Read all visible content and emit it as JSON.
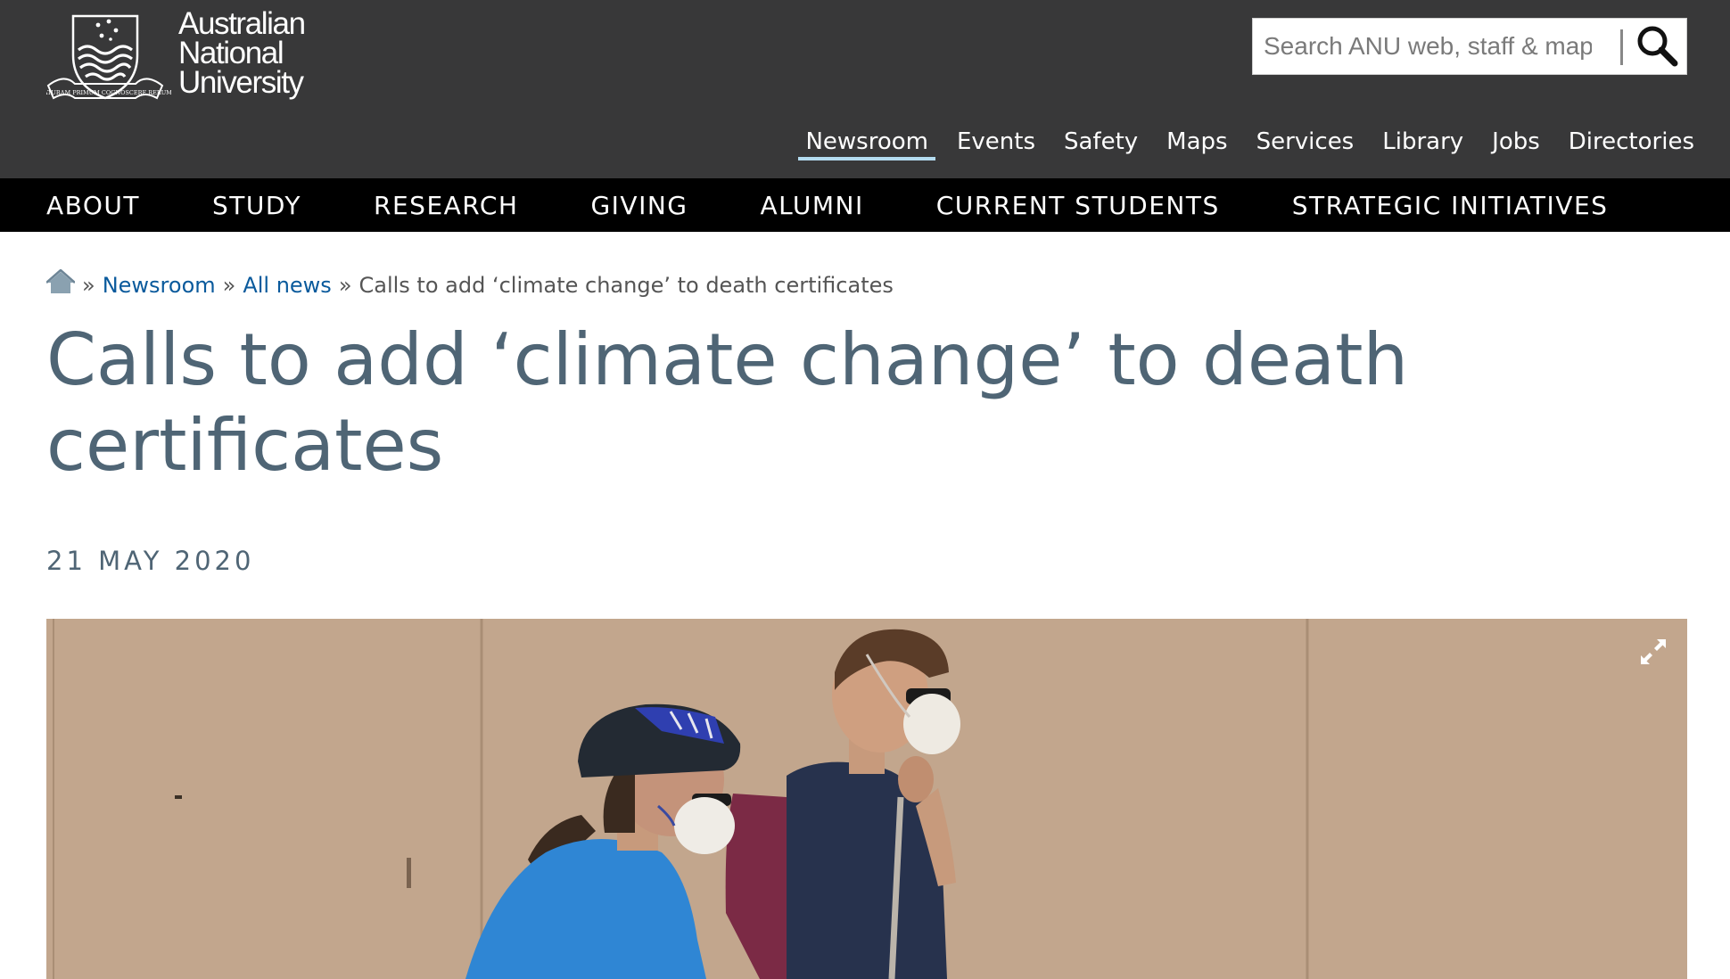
{
  "header": {
    "logo": {
      "line1": "Australian",
      "line2": "National",
      "line3": "University",
      "motto": "NATURAM PRIMUM COGNOSCERE RERUM"
    },
    "search": {
      "placeholder": "Search ANU web, staff & maps"
    },
    "utility_nav": [
      {
        "label": "Newsroom",
        "active": true
      },
      {
        "label": "Events"
      },
      {
        "label": "Safety"
      },
      {
        "label": "Maps"
      },
      {
        "label": "Services"
      },
      {
        "label": "Library"
      },
      {
        "label": "Jobs"
      },
      {
        "label": "Directories"
      }
    ]
  },
  "main_nav": [
    {
      "label": "ABOUT"
    },
    {
      "label": "STUDY"
    },
    {
      "label": "RESEARCH"
    },
    {
      "label": "GIVING"
    },
    {
      "label": "ALUMNI"
    },
    {
      "label": "CURRENT STUDENTS"
    },
    {
      "label": "STRATEGIC INITIATIVES"
    }
  ],
  "breadcrumb": {
    "items": [
      {
        "label": "Newsroom"
      },
      {
        "label": "All news"
      }
    ],
    "current": "Calls to add ‘climate change’ to death certificates",
    "separator": "»"
  },
  "article": {
    "title_line1": "Calls to add ‘climate change’ to death",
    "title_line2": "certificates",
    "date": "21 MAY 2020"
  },
  "icons": {
    "home": "home-icon",
    "search": "search-icon",
    "expand": "expand-icon"
  },
  "colors": {
    "header_bg": "#383839",
    "main_nav_bg": "#000000",
    "title_color": "#4f6575",
    "link_color": "#0a5a9c",
    "active_underline": "#b4dcf0"
  }
}
